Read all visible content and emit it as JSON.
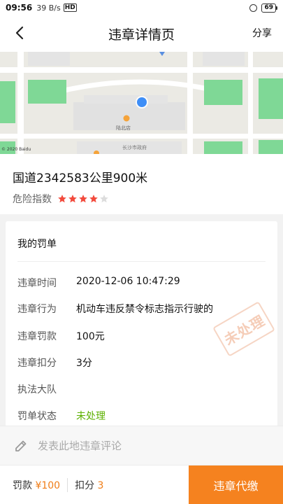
{
  "status_bar": {
    "time": "09:56",
    "network_speed": "39 B/s",
    "hd_badge": "HD",
    "battery": "69"
  },
  "header": {
    "title": "违章详情页",
    "share_label": "分享",
    "back_icon": "back-arrow-icon"
  },
  "map": {
    "credit": "© 2020 Baidu",
    "poi_label": "陆北店",
    "road_label": "长沙市政府",
    "colors": {
      "park": "#7fd896",
      "road": "#ffffff",
      "land": "#ebeae4",
      "building": "#e1e1e1",
      "marker": "#3e8ef7"
    }
  },
  "location": {
    "road": "国道2342583公里900米",
    "risk_label": "危险指数",
    "risk_stars": 4,
    "risk_max": 5
  },
  "fine": {
    "title": "我的罚单",
    "stamp": "未处理",
    "rows": [
      {
        "label": "违章时间",
        "value": "2020-12-06 10:47:29"
      },
      {
        "label": "违章行为",
        "value": "机动车违反禁令标志指示行驶的"
      },
      {
        "label": "违章罚款",
        "value": "100元"
      },
      {
        "label": "违章扣分",
        "value": "3分"
      },
      {
        "label": "执法大队",
        "value": ""
      },
      {
        "label": "罚单状态",
        "value": "未处理"
      }
    ]
  },
  "comment": {
    "placeholder": "发表此地违章评论"
  },
  "bottom_bar": {
    "fine_label": "罚款",
    "fine_value": "¥100",
    "points_label": "扣分",
    "points_value": "3",
    "pay_label": "违章代缴",
    "accent_color": "#f5821f"
  }
}
